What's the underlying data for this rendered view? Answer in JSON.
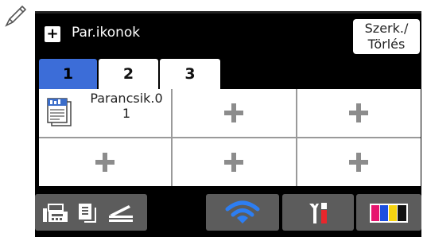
{
  "header": {
    "add_glyph": "+",
    "title": "Par.ikonok",
    "edit_button": {
      "line1": "Szerk./",
      "line2": "Törlés"
    }
  },
  "tabs": [
    {
      "label": "1",
      "active": true
    },
    {
      "label": "2",
      "active": false
    },
    {
      "label": "3",
      "active": false
    }
  ],
  "shortcuts": {
    "filled": {
      "line1": "Parancsik.0",
      "line2": "1",
      "icon": "document-icon"
    },
    "empty_icon": "plus-icon"
  },
  "bottom_bar": [
    {
      "name": "fax-copy-scan-button",
      "icons": [
        "fax-icon",
        "copy-icon",
        "scan-icon"
      ]
    },
    {
      "name": "wifi-button",
      "icon": "wifi-icon",
      "accent": "#2d7ef2"
    },
    {
      "name": "settings-button",
      "icon": "tools-icon",
      "accent": "#e8262c"
    },
    {
      "name": "ink-button",
      "icon": "ink-icon",
      "colors": [
        "#e7156e",
        "#1d4fe0",
        "#f5d311",
        "#111111"
      ]
    }
  ],
  "colors": {
    "tab_active": "#3c6dd8",
    "screen_bg": "#000000",
    "plus": "#8c8c8c"
  }
}
